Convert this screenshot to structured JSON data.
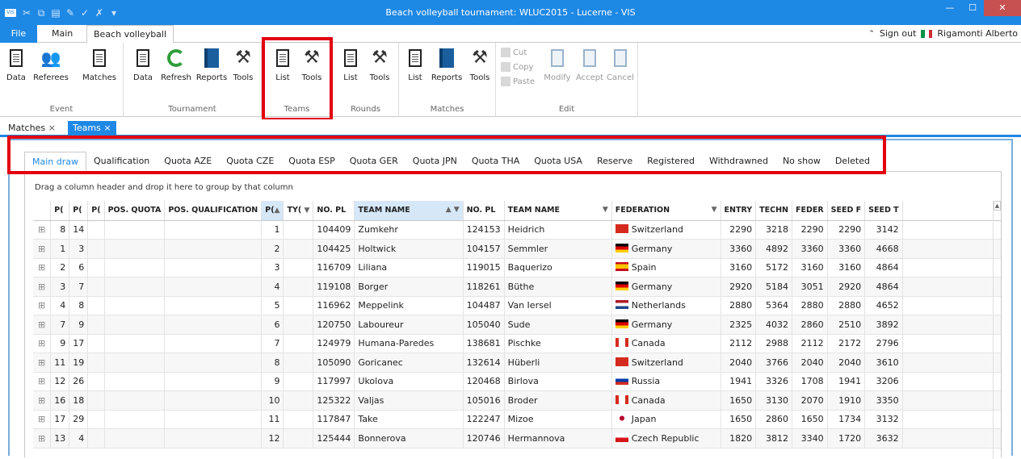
{
  "window": {
    "title": "Beach volleyball tournament: WLUC2015 - Lucerne - VIS",
    "app_icon": "VIS"
  },
  "menu": {
    "file": "File",
    "tabs": [
      "Main",
      "Beach volleyball"
    ],
    "sign_out": "Sign out",
    "user": "Rigamonti Alberto"
  },
  "ribbon": {
    "event": {
      "label": "Event",
      "buttons": [
        "Data",
        "Referees",
        "Matches"
      ]
    },
    "tournament": {
      "label": "Tournament",
      "buttons": [
        "Data",
        "Refresh",
        "Reports",
        "Tools"
      ]
    },
    "teams": {
      "label": "Teams",
      "buttons": [
        "List",
        "Tools"
      ]
    },
    "rounds": {
      "label": "Rounds",
      "buttons": [
        "List",
        "Tools"
      ]
    },
    "matches": {
      "label": "Matches",
      "buttons": [
        "List",
        "Reports",
        "Tools"
      ]
    },
    "edit": {
      "label": "Edit",
      "small": [
        "Cut",
        "Copy",
        "Paste"
      ],
      "buttons": [
        "Modify",
        "Accept",
        "Cancel"
      ]
    }
  },
  "doc_tabs": [
    "Matches",
    "Teams"
  ],
  "sub_tabs": [
    "Main draw",
    "Qualification",
    "Quota AZE",
    "Quota CZE",
    "Quota ESP",
    "Quota GER",
    "Quota JPN",
    "Quota THA",
    "Quota USA",
    "Reserve",
    "Registered",
    "Withdrawned",
    "No show",
    "Deleted"
  ],
  "group_hint": "Drag a column header and drop it here to group by that column",
  "columns": [
    "",
    "P(",
    "P(",
    "P(",
    "POS. QUOTA",
    "POS. QUALIFICATION",
    "P(",
    "TY(",
    "NO. PL",
    "TEAM NAME",
    "NO. PL",
    "TEAM NAME",
    "FEDERATION",
    "ENTRY",
    "TECHN",
    "FEDER",
    "SEED F",
    "SEED T"
  ],
  "rows": [
    [
      "8",
      "14",
      "1",
      "104409",
      "Zumkehr",
      "124153",
      "Heidrich",
      "Switzerland",
      "2290",
      "3218",
      "2290",
      "2290",
      "3142"
    ],
    [
      "1",
      "3",
      "2",
      "104425",
      "Holtwick",
      "104157",
      "Semmler",
      "Germany",
      "3360",
      "4892",
      "3360",
      "3360",
      "4668"
    ],
    [
      "2",
      "6",
      "3",
      "116709",
      "Liliana",
      "119015",
      "Baquerizo",
      "Spain",
      "3160",
      "5172",
      "3160",
      "3160",
      "4864"
    ],
    [
      "3",
      "7",
      "4",
      "119108",
      "Borger",
      "118261",
      "Büthe",
      "Germany",
      "2920",
      "5184",
      "3051",
      "2920",
      "4864"
    ],
    [
      "4",
      "8",
      "5",
      "116962",
      "Meppelink",
      "104487",
      "Van Iersel",
      "Netherlands",
      "2880",
      "5364",
      "2880",
      "2880",
      "4652"
    ],
    [
      "7",
      "9",
      "6",
      "120750",
      "Laboureur",
      "105040",
      "Sude",
      "Germany",
      "2325",
      "4032",
      "2860",
      "2510",
      "3892"
    ],
    [
      "9",
      "17",
      "7",
      "124979",
      "Humana-Paredes",
      "138681",
      "Pischke",
      "Canada",
      "2112",
      "2988",
      "2112",
      "2172",
      "2796"
    ],
    [
      "11",
      "19",
      "8",
      "105090",
      "Goricanec",
      "132614",
      "Hüberli",
      "Switzerland",
      "2040",
      "3766",
      "2040",
      "2040",
      "3610"
    ],
    [
      "12",
      "26",
      "9",
      "117997",
      "Ukolova",
      "120468",
      "Birlova",
      "Russia",
      "1941",
      "3326",
      "1708",
      "1941",
      "3206"
    ],
    [
      "16",
      "18",
      "10",
      "125322",
      "Valjas",
      "105016",
      "Broder",
      "Canada",
      "1650",
      "3130",
      "2070",
      "1910",
      "3350"
    ],
    [
      "17",
      "29",
      "11",
      "117847",
      "Take",
      "122247",
      "Mizoe",
      "Japan",
      "1650",
      "2860",
      "1650",
      "1734",
      "3132"
    ],
    [
      "13",
      "4",
      "12",
      "125444",
      "Bonnerova",
      "120746",
      "Hermannova",
      "Czech Republic",
      "1820",
      "3812",
      "3340",
      "1720",
      "3632"
    ]
  ]
}
